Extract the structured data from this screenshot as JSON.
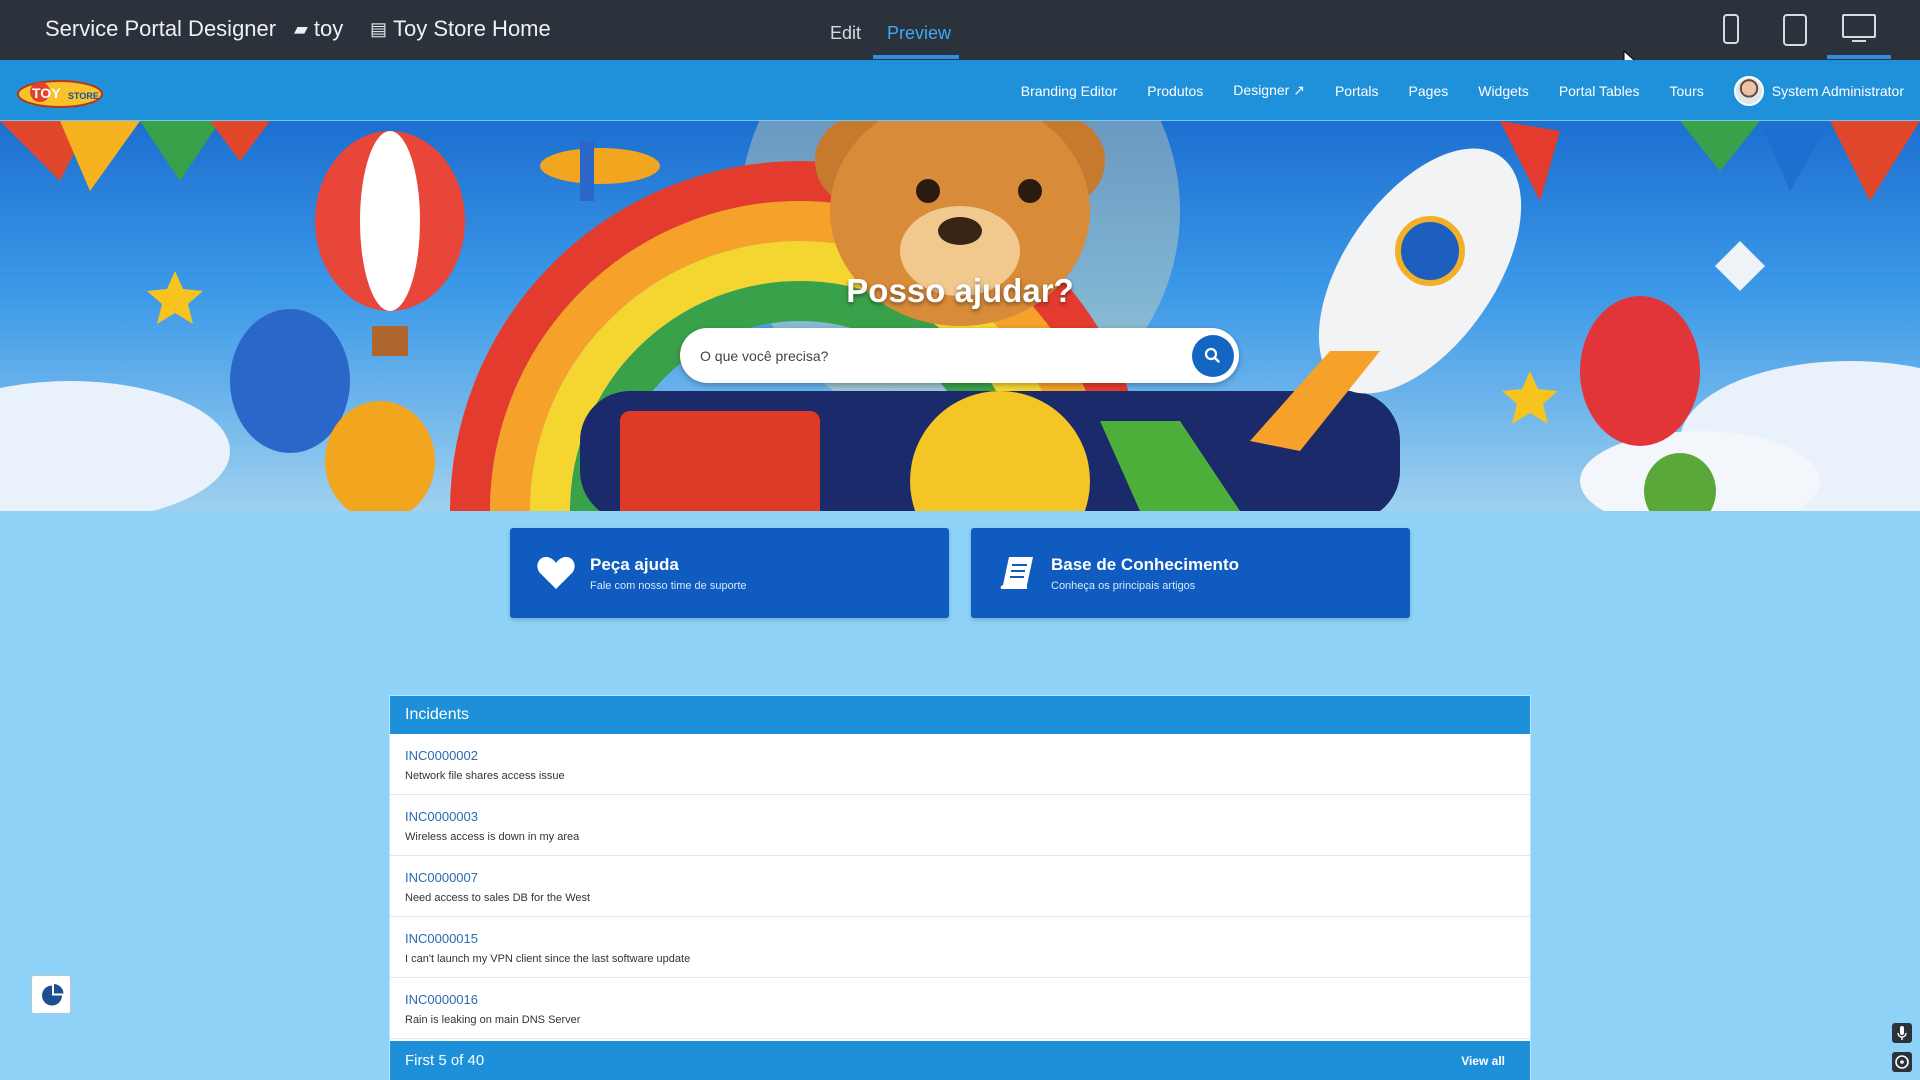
{
  "designer": {
    "title": "Service Portal Designer",
    "portal_crumb": "toy",
    "page_crumb": "Toy Store Home",
    "tabs": {
      "edit": "Edit",
      "preview": "Preview"
    },
    "active_tab": "Preview",
    "devices": [
      "phone-icon",
      "tablet-icon",
      "desktop-icon"
    ],
    "active_device": "desktop-icon"
  },
  "navbar": {
    "logo_text": "TOY STORE",
    "items": [
      "Branding Editor",
      "Produtos",
      "Designer ↗",
      "Portals",
      "Pages",
      "Widgets",
      "Portal Tables",
      "Tours"
    ],
    "user_name": "System Administrator"
  },
  "hero": {
    "title": "Posso ajudar?",
    "search_placeholder": "O que você precisa?"
  },
  "cards": [
    {
      "title": "Peça ajuda",
      "subtitle": "Fale com nosso time de suporte",
      "icon": "heart-icon"
    },
    {
      "title": "Base de Conhecimento",
      "subtitle": "Conheça os principais artigos",
      "icon": "book-icon"
    }
  ],
  "incidents": {
    "header": "Incidents",
    "rows": [
      {
        "number": "INC0000002",
        "description": "Network file shares access issue"
      },
      {
        "number": "INC0000003",
        "description": "Wireless access is down in my area"
      },
      {
        "number": "INC0000007",
        "description": "Need access to sales DB for the West"
      },
      {
        "number": "INC0000015",
        "description": "I can't launch my VPN client since the last software update"
      },
      {
        "number": "INC0000016",
        "description": "Rain is leaking on main DNS Server"
      }
    ],
    "footer_count": "First 5 of 40",
    "view_all": "View all"
  },
  "colors": {
    "designer_bar": "#2b323c",
    "navbar": "#1f90da",
    "card": "#0f5bbf",
    "page_bg": "#8ed3f7",
    "accent": "#3ea8f4"
  }
}
